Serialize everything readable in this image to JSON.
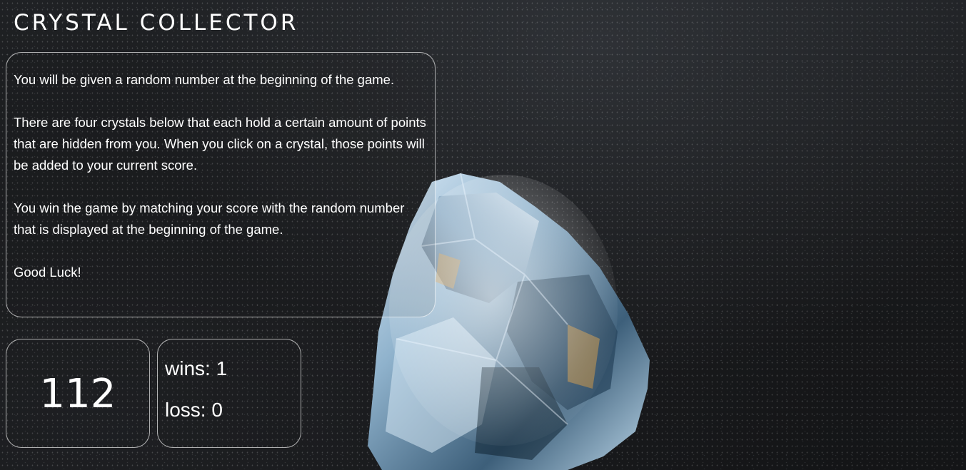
{
  "game": {
    "title": "CRYSTAL COLLECTOR"
  },
  "instructions": {
    "paragraphs": [
      "You will be given a random number at the beginning of the game.",
      "There are four crystals below that each hold a certain amount of points that are hidden from you. When you click on a crystal, those points will be added to your current score.",
      "You win the game by matching your score with the random number that is displayed at the beginning of the game.",
      "Good Luck!"
    ]
  },
  "target": {
    "number": "112"
  },
  "score": {
    "wins_text": "wins: 1",
    "loss_text": "loss: 0"
  },
  "colors": {
    "text": "#ffffff",
    "panel_border": "#cfcfcf",
    "background": "#18191b"
  }
}
